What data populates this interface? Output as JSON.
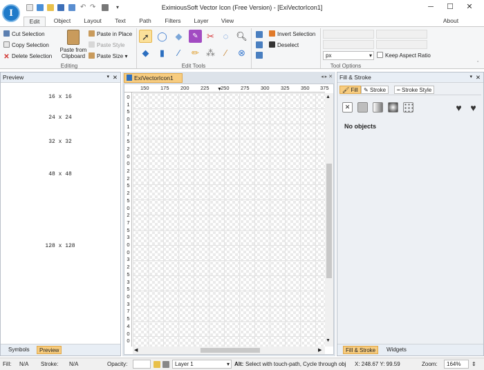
{
  "app": {
    "title": "EximiousSoft Vector Icon (Free Version) - [ExiVectorIcon1]",
    "logo_letter": "I",
    "window_controls": [
      "─",
      "☐",
      "✕"
    ]
  },
  "menu_tabs": [
    "Edit",
    "Object",
    "Layout",
    "Text",
    "Path",
    "Filters",
    "Layer",
    "View"
  ],
  "active_tab": "Edit",
  "about_label": "About",
  "ribbon": {
    "editing": {
      "cut": "Cut Selection",
      "copy": "Copy Selection",
      "delete": "Delete Selection",
      "paste_from_clipboard": "Paste from Clipboard",
      "paste_in_place": "Paste in Place",
      "paste_style": "Paste Style",
      "paste_size": "Paste Size",
      "group_label": "Editing"
    },
    "edit_tools": {
      "group_label": "Edit Tools",
      "tools": [
        "select-arrow",
        "shapes",
        "eraser",
        "node-edit",
        "scissors",
        "zoom",
        "fill-bucket",
        "bottle",
        "eyedropper",
        "pencil",
        "spray",
        "brush",
        "lasso",
        "circle-tool"
      ]
    },
    "selection": {
      "invert": "Invert Selection",
      "deselect": "Deselect"
    },
    "tool_options": {
      "group_label": "Tool Options",
      "unit": "px",
      "keep_aspect": "Keep Aspect Ratio"
    }
  },
  "preview_panel": {
    "title": "Preview",
    "sizes": [
      "16 x 16",
      "24 x 24",
      "32 x 32",
      "48 x 48",
      "128 x 128"
    ],
    "tabs": [
      "Symbols",
      "Preview"
    ]
  },
  "document": {
    "tab": "ExiVectorIcon1",
    "ruler_top": [
      "150",
      "175",
      "200",
      "225",
      "250",
      "275",
      "300",
      "325",
      "350",
      "375"
    ],
    "ruler_left": [
      "0",
      "1",
      "5",
      "0",
      "1",
      "7",
      "5",
      "2",
      "0",
      "0",
      "2",
      "2",
      "5",
      "2",
      "5",
      "0",
      "2",
      "7",
      "5",
      "3",
      "0",
      "0",
      "3",
      "2",
      "5",
      "3",
      "5",
      "0",
      "3",
      "7",
      "5",
      "4",
      "0",
      "0"
    ]
  },
  "fill_stroke": {
    "title": "Fill & Stroke",
    "tabs": [
      "Fill",
      "Stroke",
      "Stroke Style"
    ],
    "no_objects": "No objects",
    "bottom_tabs": [
      "Fill & Stroke",
      "Widgets"
    ]
  },
  "status": {
    "fill_label": "Fill:",
    "fill_value": "N/A",
    "stroke_label": "Stroke:",
    "stroke_value": "N/A",
    "opacity_label": "Opacity:",
    "layer": "Layer 1",
    "hint_bold": "Alt:",
    "hint": "Select with touch-path, Cycle through obj",
    "coords": "X: 248.67 Y:  99.59",
    "zoom_label": "Zoom:",
    "zoom_value": "164%"
  },
  "colors": {
    "accent": "#f3b64a",
    "doc_tab": "#f7cc7f",
    "logo": "#1f7ac9"
  }
}
